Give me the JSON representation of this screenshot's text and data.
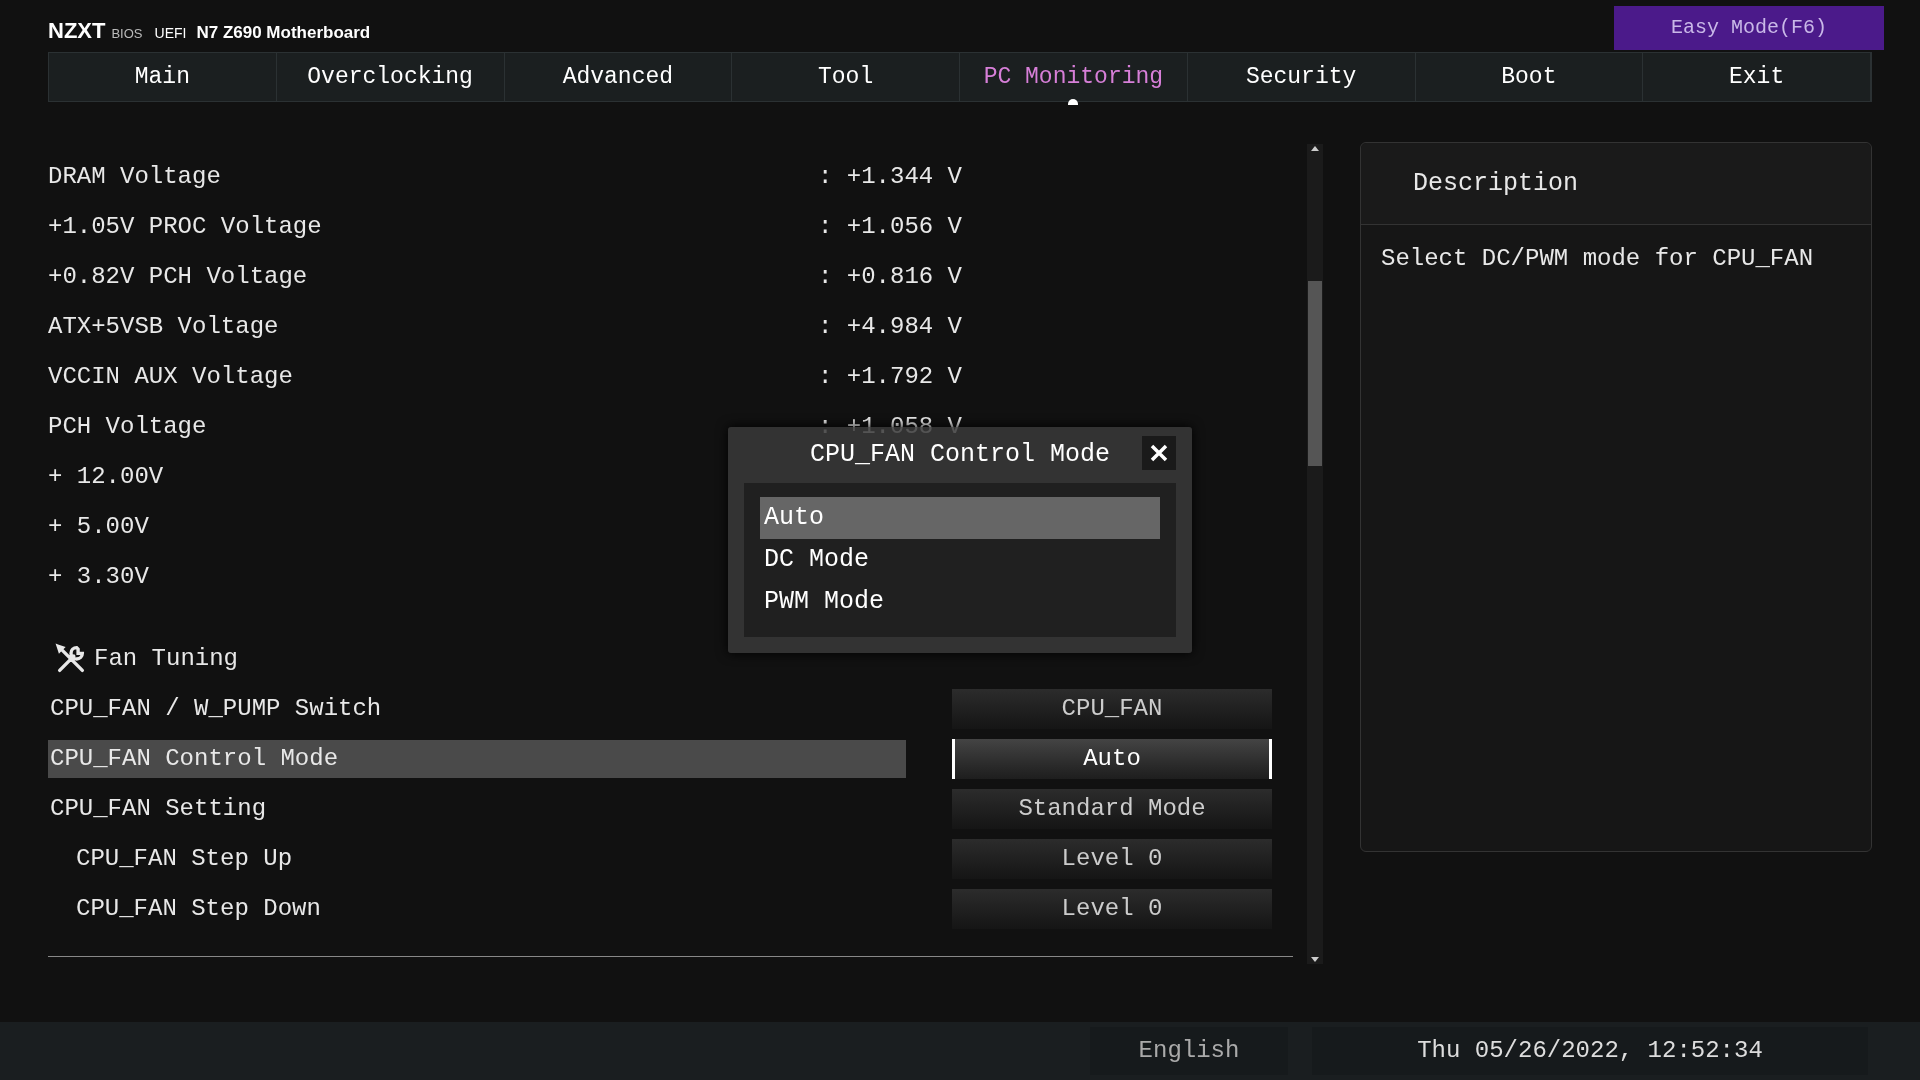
{
  "header": {
    "brand": "NZXT",
    "bios": "BIOS",
    "uefi": "UEFI",
    "model": "N7 Z690 Motherboard",
    "easy_mode": "Easy Mode(F6)"
  },
  "tabs": [
    {
      "label": "Main",
      "selected": false
    },
    {
      "label": "Overclocking",
      "selected": false
    },
    {
      "label": "Advanced",
      "selected": false
    },
    {
      "label": "Tool",
      "selected": false
    },
    {
      "label": "PC Monitoring",
      "selected": true
    },
    {
      "label": "Security",
      "selected": false
    },
    {
      "label": "Boot",
      "selected": false
    },
    {
      "label": "Exit",
      "selected": false
    }
  ],
  "readings": [
    {
      "label": "DRAM Voltage",
      "value": ": +1.344 V"
    },
    {
      "label": "+1.05V PROC Voltage",
      "value": ": +1.056 V"
    },
    {
      "label": "+0.82V PCH Voltage",
      "value": ": +0.816 V"
    },
    {
      "label": "ATX+5VSB Voltage",
      "value": ": +4.984 V"
    },
    {
      "label": "VCCIN AUX Voltage",
      "value": ": +1.792 V"
    },
    {
      "label": "PCH Voltage",
      "value": ": +1.058 V"
    },
    {
      "label": "+ 12.00V"
    },
    {
      "label": "+ 5.00V"
    },
    {
      "label": "+ 3.30V"
    }
  ],
  "section": {
    "title": "Fan Tuning"
  },
  "settings": [
    {
      "label": "CPU_FAN / W_PUMP Switch",
      "value": "CPU_FAN",
      "selected": false,
      "indented": false
    },
    {
      "label": "CPU_FAN Control Mode",
      "value": "Auto",
      "selected": true,
      "indented": false
    },
    {
      "label": "CPU_FAN Setting",
      "value": "Standard Mode",
      "selected": false,
      "indented": false
    },
    {
      "label": "CPU_FAN Step Up",
      "value": "Level 0",
      "selected": false,
      "indented": true
    },
    {
      "label": "CPU_FAN Step Down",
      "value": "Level 0",
      "selected": false,
      "indented": true
    }
  ],
  "popup": {
    "title": "CPU_FAN Control Mode",
    "options": [
      {
        "label": "Auto",
        "selected": true
      },
      {
        "label": "DC Mode",
        "selected": false
      },
      {
        "label": "PWM Mode",
        "selected": false
      }
    ]
  },
  "description": {
    "title": "Description",
    "text": "Select DC/PWM mode for CPU_FAN"
  },
  "footer": {
    "language": "English",
    "datetime": "Thu 05/26/2022, 12:52:34"
  }
}
